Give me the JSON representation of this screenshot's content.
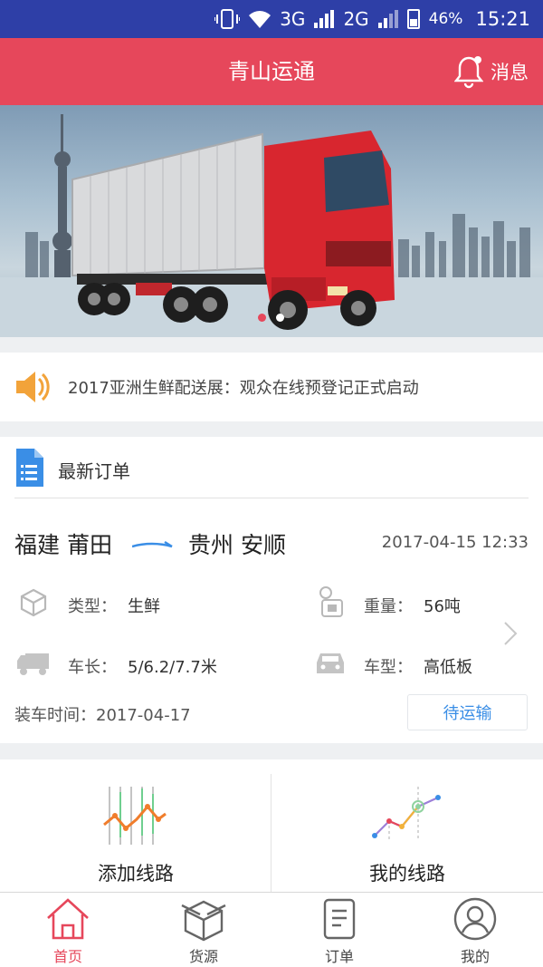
{
  "status_bar": {
    "network1": "3G",
    "network2": "2G",
    "battery": "46%",
    "time": "15:21"
  },
  "header": {
    "title": "青山运通",
    "message_label": "消息"
  },
  "banner": {
    "slide_count": 2,
    "active_slide": 1
  },
  "notice": {
    "text": "2017亚洲生鲜配送展：观众在线预登记正式启动"
  },
  "latest_orders": {
    "section_title": "最新订单",
    "order": {
      "from": "福建 莆田",
      "to": "贵州 安顺",
      "datetime": "2017-04-15 12:33",
      "type_label": "类型：",
      "type_value": "生鲜",
      "weight_label": "重量：",
      "weight_value": "56吨",
      "length_label": "车长：",
      "length_value": "5/6.2/7.7米",
      "vehicle_label": "车型：",
      "vehicle_value": "高低板",
      "load_time": "装车时间：2017-04-17",
      "status": "待运输"
    }
  },
  "actions": {
    "add_route": "添加线路",
    "my_routes": "我的线路"
  },
  "tabbar": {
    "home": "首页",
    "goods": "货源",
    "orders": "订单",
    "mine": "我的"
  },
  "colors": {
    "brand": "#e6475b",
    "status_bar": "#2e3fa7",
    "link": "#3a8ee6"
  }
}
